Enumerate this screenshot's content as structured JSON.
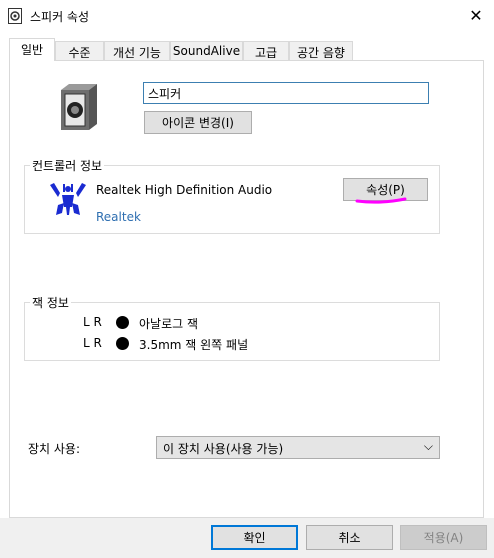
{
  "window": {
    "title": "스피커 속성",
    "close_glyph": "✕"
  },
  "tabs": [
    {
      "label": "일반",
      "active": true
    },
    {
      "label": "수준"
    },
    {
      "label": "개선 기능"
    },
    {
      "label": "SoundAlive"
    },
    {
      "label": "고급"
    },
    {
      "label": "공간 음향"
    }
  ],
  "device": {
    "name": "스피커",
    "change_icon_label": "아이콘 변경(I)"
  },
  "controller": {
    "section_label": "컨트롤러 정보",
    "name": "Realtek High Definition Audio",
    "vendor": "Realtek",
    "properties_label": "속성(P)"
  },
  "jack": {
    "section_label": "잭 정보",
    "rows": [
      {
        "lr": "L R",
        "label": "아날로그 잭"
      },
      {
        "lr": "L R",
        "label": "3.5mm 잭 왼쪽 패널"
      }
    ]
  },
  "usage": {
    "label": "장치 사용:",
    "selected": "이 장치 사용(사용 가능)"
  },
  "buttons": {
    "ok": "확인",
    "cancel": "취소",
    "apply": "적용(A)"
  },
  "colors": {
    "accent": "#0078d7",
    "annotation": "#ff00ff",
    "link": "#2f6fb1",
    "realtek_blue": "#1a2bd1"
  },
  "icons": [
    "speaker-properties-icon",
    "close-icon",
    "speaker-device-icon",
    "realtek-logo",
    "chevron-down-icon",
    "jack-dot-icon"
  ]
}
